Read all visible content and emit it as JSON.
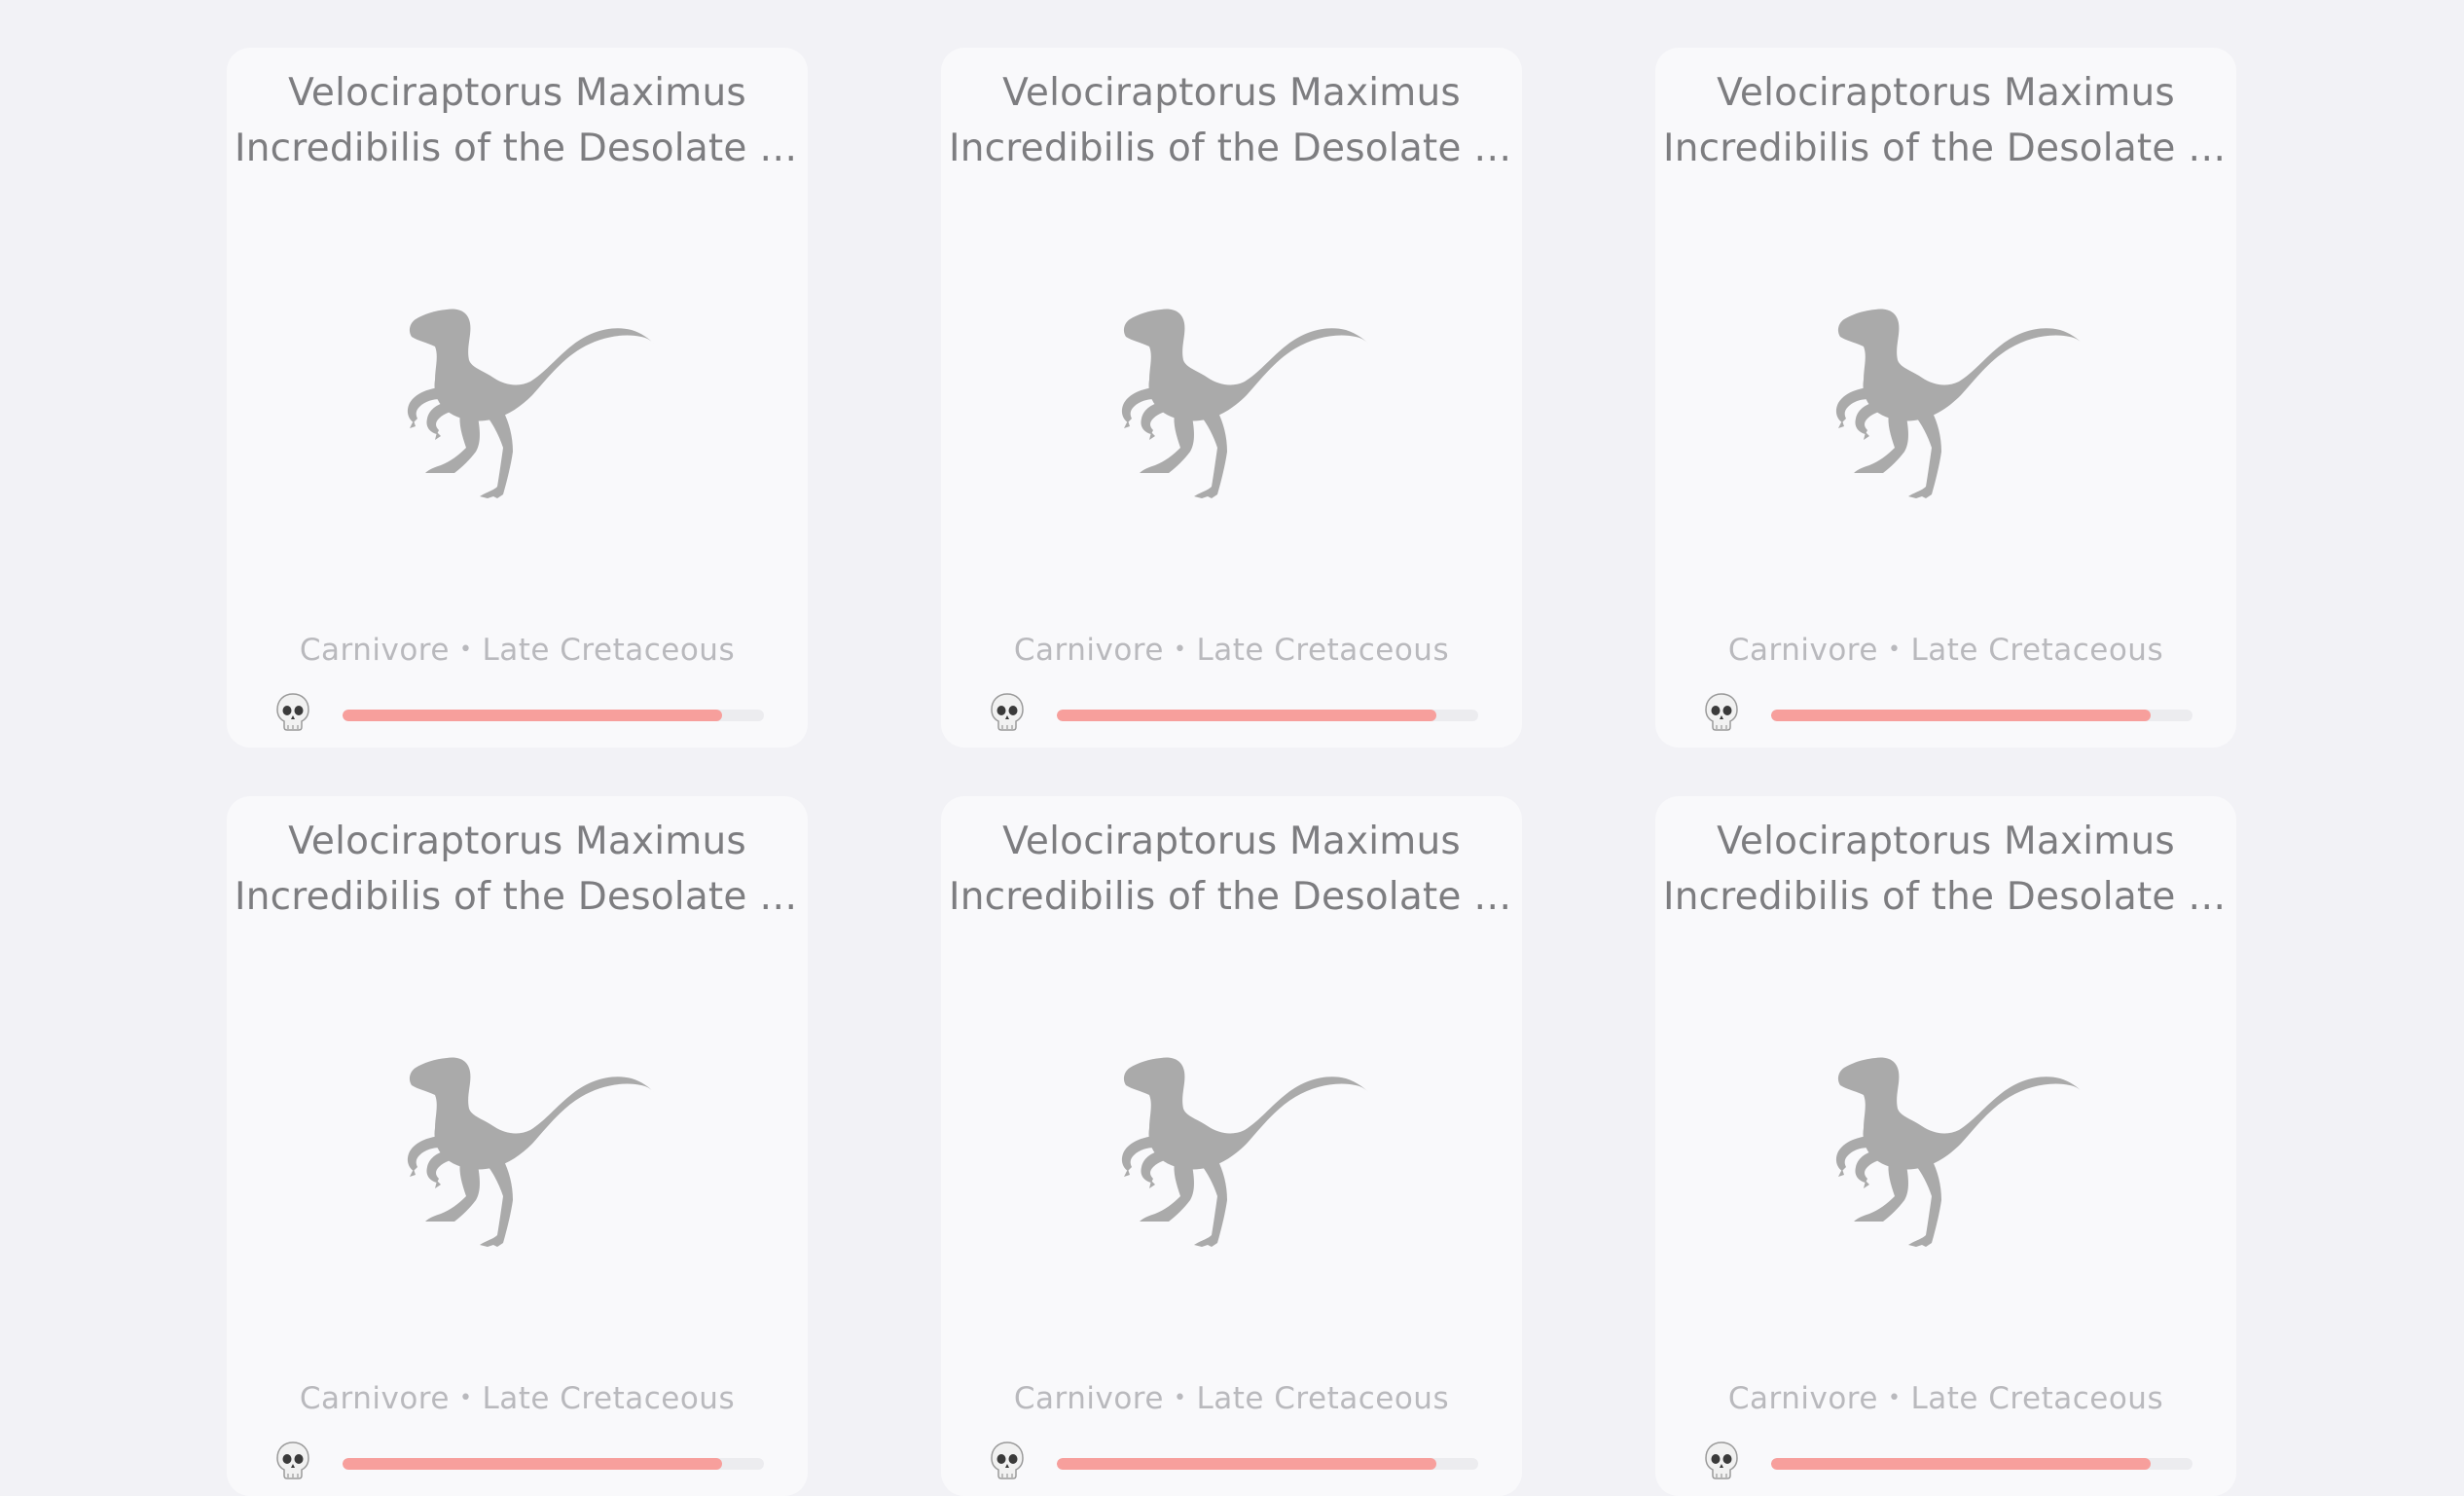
{
  "cards": [
    {
      "title_line1": "Velociraptorus Maximus",
      "title_line2": "Incredibilis of the Desolate E…",
      "diet": "Carnivore",
      "separator": "•",
      "period": "Late Cretaceous",
      "danger_icon": "skull-icon",
      "danger_level": 0.9
    },
    {
      "title_line1": "Velociraptorus Maximus",
      "title_line2": "Incredibilis of the Desolate E…",
      "diet": "Carnivore",
      "separator": "•",
      "period": "Late Cretaceous",
      "danger_icon": "skull-icon",
      "danger_level": 0.9
    },
    {
      "title_line1": "Velociraptorus Maximus",
      "title_line2": "Incredibilis of the Desolate E…",
      "diet": "Carnivore",
      "separator": "•",
      "period": "Late Cretaceous",
      "danger_icon": "skull-icon",
      "danger_level": 0.9
    },
    {
      "title_line1": "Velociraptorus Maximus",
      "title_line2": "Incredibilis of the Desolate E…",
      "diet": "Carnivore",
      "separator": "•",
      "period": "Late Cretaceous",
      "danger_icon": "skull-icon",
      "danger_level": 0.9
    },
    {
      "title_line1": "Velociraptorus Maximus",
      "title_line2": "Incredibilis of the Desolate E…",
      "diet": "Carnivore",
      "separator": "•",
      "period": "Late Cretaceous",
      "danger_icon": "skull-icon",
      "danger_level": 0.9
    },
    {
      "title_line1": "Velociraptorus Maximus",
      "title_line2": "Incredibilis of the Desolate E…",
      "diet": "Carnivore",
      "separator": "•",
      "period": "Late Cretaceous",
      "danger_icon": "skull-icon",
      "danger_level": 0.9
    }
  ],
  "colors": {
    "background": "#f2f2f6",
    "card": "#f9f9fb",
    "title": "#7d7d80",
    "meta": "#b9b9bd",
    "dino": "#aaaaaa",
    "bar_fill": "#f79f9c",
    "bar_track": "#ececef"
  },
  "icons": {
    "card_image": "velociraptor-silhouette-icon",
    "danger": "skull-icon"
  }
}
